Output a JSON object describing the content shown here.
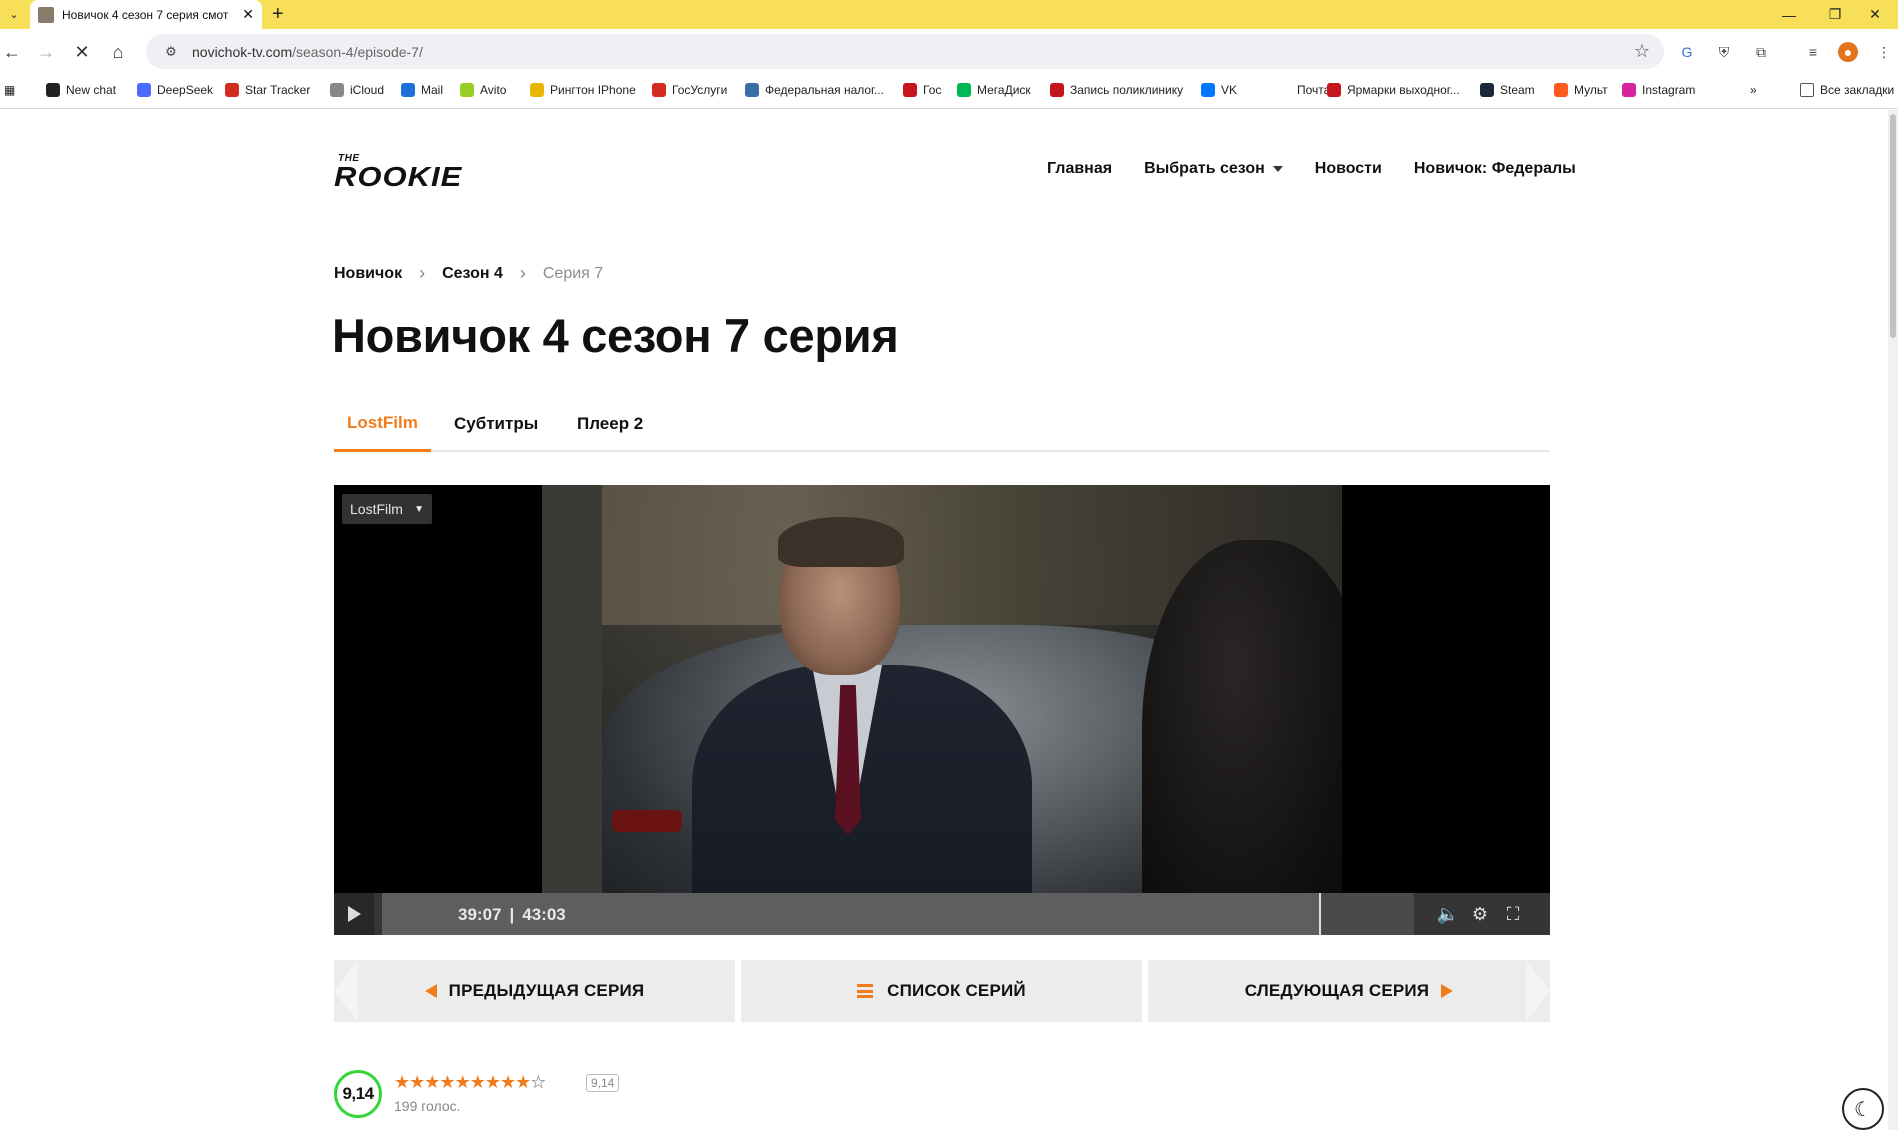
{
  "browser": {
    "tab_title": "Новичок 4 сезон 7 серия смот",
    "url_host": "novichok-tv.com",
    "url_path": "/season-4/episode-7/",
    "bookmarks": [
      {
        "label": "New chat",
        "color": "#222222"
      },
      {
        "label": "DeepSeek",
        "color": "#4d6bfe"
      },
      {
        "label": "Star Tracker",
        "color": "#d12a1f"
      },
      {
        "label": "iCloud",
        "color": "#888888"
      },
      {
        "label": "Mail",
        "color": "#1e6fd9"
      },
      {
        "label": "Avito",
        "color": "#97cf26"
      },
      {
        "label": "Рингтон IPhone",
        "color": "#e8b600"
      },
      {
        "label": "ГосУслуги",
        "color": "#d52b1e"
      },
      {
        "label": "Федеральная налог...",
        "color": "#3a6ea5"
      },
      {
        "label": "Гос",
        "color": "#c4161c"
      },
      {
        "label": "МегаДиск",
        "color": "#00b956"
      },
      {
        "label": "Запись поликлинику",
        "color": "#c4161c"
      },
      {
        "label": "VK",
        "color": "#0077ff"
      },
      {
        "label": "Почта",
        "color": "#ffffff"
      },
      {
        "label": "Ярмарки выходног...",
        "color": "#c4161c"
      },
      {
        "label": "Steam",
        "color": "#1b2838"
      },
      {
        "label": "Мульт",
        "color": "#ff5a1f"
      },
      {
        "label": "Instagram",
        "color": "#d6249f"
      }
    ],
    "all_bookmarks": "Все закладки",
    "more": "»"
  },
  "site": {
    "logo_top": "THE",
    "logo_main": "ROOKIE",
    "nav": {
      "home": "Главная",
      "season": "Выбрать сезон",
      "news": "Новости",
      "feds": "Новичок: Федералы"
    }
  },
  "breadcrumb": {
    "root": "Новичок",
    "season": "Сезон 4",
    "current": "Серия 7"
  },
  "page_title": "Новичок 4 сезон 7 серия",
  "player_tabs": [
    "LostFilm",
    "Субтитры",
    "Плеер 2"
  ],
  "player": {
    "voice": "LostFilm",
    "current_time": "39:07",
    "sep": "|",
    "duration": "43:03",
    "progress": 0.908
  },
  "episode_nav": {
    "prev": "ПРЕДЫДУЩАЯ СЕРИЯ",
    "list": "СПИСОК СЕРИЙ",
    "next": "СЛЕДУЮЩАЯ СЕРИЯ"
  },
  "rating": {
    "score": "9,14",
    "badge": "9,14",
    "votes": "199 голос.",
    "stars_filled": 9,
    "stars_total": 10,
    "ring_color": "#35d63a",
    "accent": "#f07c1d"
  }
}
